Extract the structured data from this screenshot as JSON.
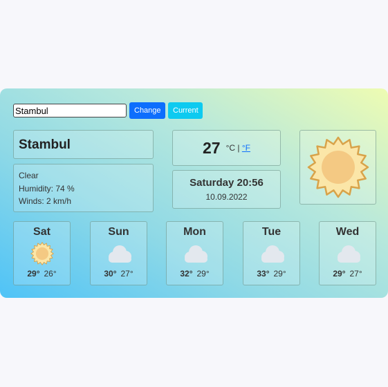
{
  "search": {
    "value": "Stambul",
    "change_label": "Change",
    "current_label": "Current"
  },
  "current": {
    "city": "Stambul",
    "description": "Clear",
    "humidity": "Humidity: 74 %",
    "winds": "Winds: 2 km/h",
    "temperature": "27",
    "unit_c": "°C",
    "unit_sep": "|",
    "unit_f": "°F",
    "day_time": "Saturday 20:56",
    "date": "10.09.2022",
    "icon": "sun-icon"
  },
  "forecast": [
    {
      "day": "Sat",
      "max": "29°",
      "min": "26°",
      "icon": "sun-icon"
    },
    {
      "day": "Sun",
      "max": "30°",
      "min": "27°",
      "icon": "cloud-icon"
    },
    {
      "day": "Mon",
      "max": "32°",
      "min": "29°",
      "icon": "cloud-icon"
    },
    {
      "day": "Tue",
      "max": "33°",
      "min": "29°",
      "icon": "cloud-icon"
    },
    {
      "day": "Wed",
      "max": "29°",
      "min": "27°",
      "icon": "cloud-icon"
    }
  ],
  "colors": {
    "button_primary": "#0d6efd",
    "button_info": "#0dcaf0",
    "sun_fill": "#f4c983",
    "sun_stroke": "#d8a34a",
    "cloud_fill": "#e3e8ee"
  }
}
